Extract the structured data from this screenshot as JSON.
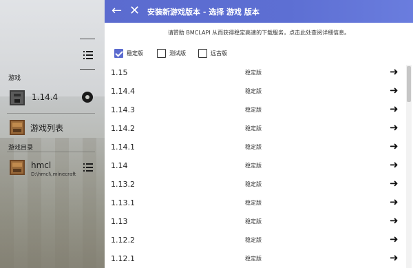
{
  "header": {
    "title": "安装新游戏版本 - 选择 游戏 版本",
    "back_icon": "arrow-left-icon",
    "close_icon": "close-icon",
    "accent": "#5b6bcf"
  },
  "notice": "请赞助 BMCLAPI 从而获得稳定高速的下载服务，点击此处查阅详细信息。",
  "filters": [
    {
      "label": "稳定版",
      "checked": true
    },
    {
      "label": "测试版",
      "checked": false
    },
    {
      "label": "远古版",
      "checked": false
    }
  ],
  "sidebar": {
    "games_label": "游戏",
    "current_version": "1.14.4",
    "game_list_label": "游戏列表",
    "dirs_label": "游戏目录",
    "dir_name": "hmcl",
    "dir_path": "D:\\hmcl\\.minecraft"
  },
  "versions": [
    {
      "version": "1.15",
      "type": "稳定版"
    },
    {
      "version": "1.14.4",
      "type": "稳定版"
    },
    {
      "version": "1.14.3",
      "type": "稳定版"
    },
    {
      "version": "1.14.2",
      "type": "稳定版"
    },
    {
      "version": "1.14.1",
      "type": "稳定版"
    },
    {
      "version": "1.14",
      "type": "稳定版"
    },
    {
      "version": "1.13.2",
      "type": "稳定版"
    },
    {
      "version": "1.13.1",
      "type": "稳定版"
    },
    {
      "version": "1.13",
      "type": "稳定版"
    },
    {
      "version": "1.12.2",
      "type": "稳定版"
    },
    {
      "version": "1.12.1",
      "type": "稳定版"
    }
  ]
}
